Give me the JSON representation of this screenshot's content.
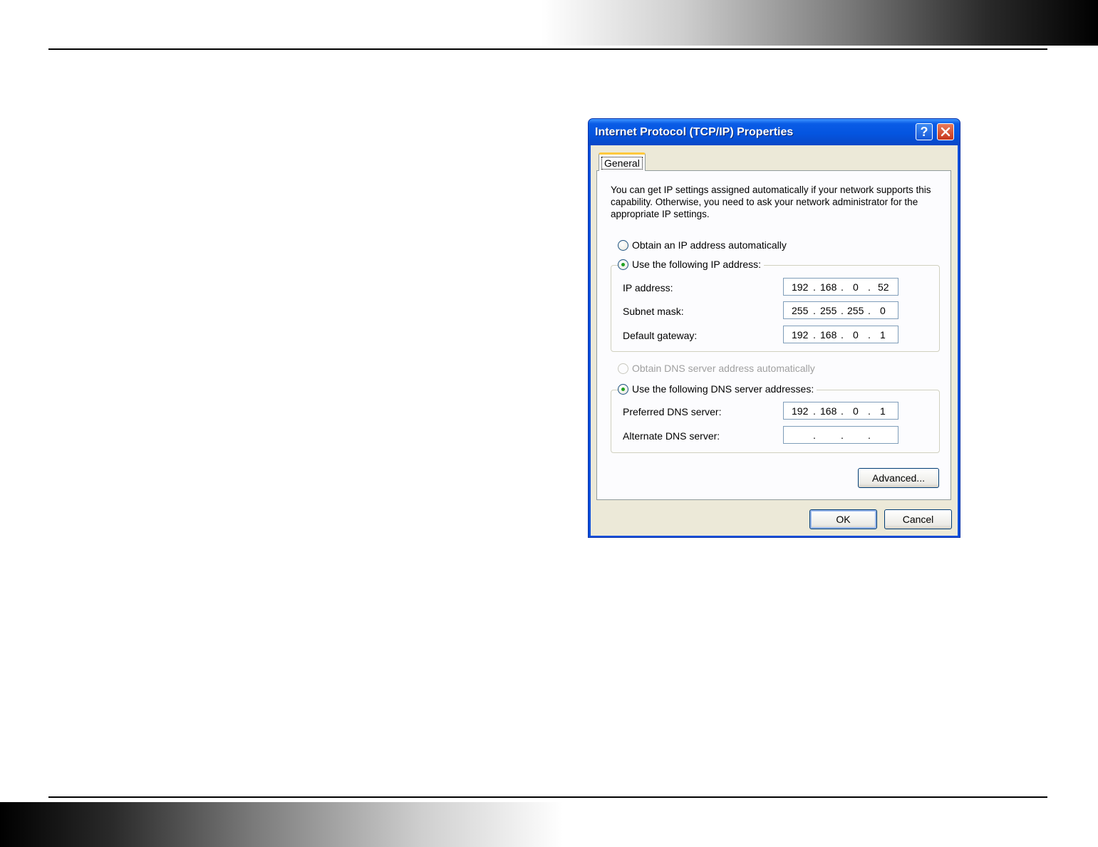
{
  "dialog": {
    "title": "Internet Protocol (TCP/IP) Properties",
    "help_glyph": "?",
    "tab_general": "General",
    "description": "You can get IP settings assigned automatically if your network supports this capability. Otherwise, you need to ask your network administrator for the appropriate IP settings.",
    "ip_auto_label": "Obtain an IP address automatically",
    "ip_manual_label": "Use the following IP address:",
    "ip_address_label": "IP address:",
    "ip_address": [
      "192",
      "168",
      "0",
      "52"
    ],
    "subnet_label": "Subnet mask:",
    "subnet": [
      "255",
      "255",
      "255",
      "0"
    ],
    "gateway_label": "Default gateway:",
    "gateway": [
      "192",
      "168",
      "0",
      "1"
    ],
    "dns_auto_label": "Obtain DNS server address automatically",
    "dns_manual_label": "Use the following DNS server addresses:",
    "preferred_dns_label": "Preferred DNS server:",
    "preferred_dns": [
      "192",
      "168",
      "0",
      "1"
    ],
    "alternate_dns_label": "Alternate DNS server:",
    "alternate_dns": [
      "",
      "",
      "",
      ""
    ],
    "dot": ".",
    "advanced_button": "Advanced...",
    "ok_button": "OK",
    "cancel_button": "Cancel"
  }
}
